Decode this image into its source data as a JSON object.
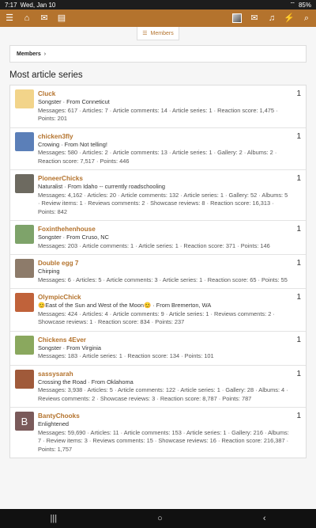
{
  "status": {
    "time": "7:17",
    "date": "Wed, Jan 10",
    "battery": "85%"
  },
  "appbar": {
    "icons": [
      "menu-icon",
      "home-icon",
      "chat-icon",
      "document-icon",
      "avatar",
      "mail-icon",
      "bell-icon",
      "bolt-icon",
      "search-icon"
    ]
  },
  "members_tab": {
    "label": "Members"
  },
  "members_box": {
    "label": "Members"
  },
  "section": {
    "title": "Most article series"
  },
  "users": [
    {
      "name": "Cluck",
      "title": "Songster · From Conneticut",
      "meta": "Messages: 617 · Articles: 7 · Article comments: 14 · Article series: 1 · Reaction score: 1,475 · Points: 201",
      "count": "1",
      "color": "#f2d48a"
    },
    {
      "name": "chicken3fly",
      "title": "Crowing · From Not telling!",
      "meta": "Messages: 580 · Articles: 2 · Article comments: 13 · Article series: 1 · Gallery: 2 · Albums: 2 · Reaction score: 7,517 · Points: 446",
      "count": "1",
      "color": "#5b7fb8"
    },
    {
      "name": "PioneerChicks",
      "title": "Naturalist · From Idaho -- currently roadschooling",
      "meta": "Messages: 4,162 · Articles: 20 · Article comments: 132 · Article series: 1 · Gallery: 52 · Albums: 5 · Review items: 1 · Reviews comments: 2 · Showcase reviews: 8 · Reaction score: 16,313 · Points: 842",
      "count": "1",
      "color": "#6d6a60"
    },
    {
      "name": "Foxinthehenhouse",
      "title": "Songster · From Cruso, NC",
      "meta": "Messages: 203 · Article comments: 1 · Article series: 1 · Reaction score: 371 · Points: 146",
      "count": "1",
      "color": "#7ea36a"
    },
    {
      "name": "Double egg 7",
      "title": "Chirping",
      "meta": "Messages: 6 · Articles: 5 · Article comments: 3 · Article series: 1 · Reaction score: 65 · Points: 55",
      "count": "1",
      "color": "#8d7b6a"
    },
    {
      "name": "OlympicChick",
      "title": "😊East of the Sun and West of the Moon😊 · From Bremerton, WA",
      "meta": "Messages: 424 · Articles: 4 · Article comments: 9 · Article series: 1 · Reviews comments: 2 · Showcase reviews: 1 · Reaction score: 834 · Points: 237",
      "count": "1",
      "color": "#c0623a"
    },
    {
      "name": "Chickens 4Ever",
      "title": "Songster · From Virginia",
      "meta": "Messages: 183 · Article series: 1 · Reaction score: 134 · Points: 101",
      "count": "1",
      "color": "#8aa85e"
    },
    {
      "name": "sassysarah",
      "title": "Crossing the Road · From Oklahoma",
      "meta": "Messages: 3,938 · Articles: 5 · Article comments: 122 · Article series: 1 · Gallery: 28 · Albums: 4 · Reviews comments: 2 · Showcase reviews: 3 · Reaction score: 8,787 · Points: 787",
      "count": "1",
      "color": "#a05a3a"
    },
    {
      "name": "BantyChooks",
      "title": "Enlightened",
      "meta": "Messages: 59,690 · Articles: 11 · Article comments: 153 · Article series: 1 · Gallery: 216 · Albums: 7 · Review items: 3 · Reviews comments: 15 · Showcase reviews: 16 · Reaction score: 216,387 · Points: 1,757",
      "count": "1",
      "color": "#7a5a5a",
      "initial": "B"
    }
  ],
  "navbar": {
    "recents": "|||",
    "home": "○",
    "back": "‹"
  }
}
